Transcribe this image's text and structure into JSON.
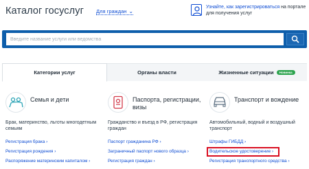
{
  "header": {
    "title": "Каталог госуслуг",
    "audience": "Для граждан",
    "login_text_link": "Узнайте, как зарегистрироваться",
    "login_text_rest": " на портале для получения услуг"
  },
  "search": {
    "placeholder": "Введите название услуги или ведомства"
  },
  "tabs": [
    {
      "label": "Категории услуг"
    },
    {
      "label": "Органы власти"
    },
    {
      "label": "Жизненные ситуации",
      "badge": "Новинка"
    }
  ],
  "categories": [
    {
      "title": "Семья и дети",
      "desc": "Брак, материнство, льготы многодетным семьям",
      "links": [
        "Регистрация брака ›",
        "Регистрация рождения ›",
        "Распоряжение материнским капиталом ›"
      ]
    },
    {
      "title": "Паспорта, регистрации, визы",
      "desc": "Гражданство и въезд в РФ, регистрация граждан",
      "links": [
        "Паспорт гражданина РФ ›",
        "Заграничный паспорт нового образца ›",
        "Регистрация граждан ›"
      ]
    },
    {
      "title": "Транспорт и вождение",
      "desc": "Автомобильный, водный и воздушный транспорт",
      "links": [
        "Штрафы ГИБДД ›",
        "Водительское удостоверение ›",
        "Регистрация транспортного средства ›"
      ]
    }
  ],
  "colors": {
    "accent": "#0d4cd3",
    "search_bg": "#0d5eab",
    "highlight": "#d90c1f",
    "badge": "#2ea44f"
  },
  "icons": [
    "login-icon",
    "search-icon",
    "family-icon",
    "passport-icon",
    "car-icon",
    "chevron-down-icon"
  ]
}
